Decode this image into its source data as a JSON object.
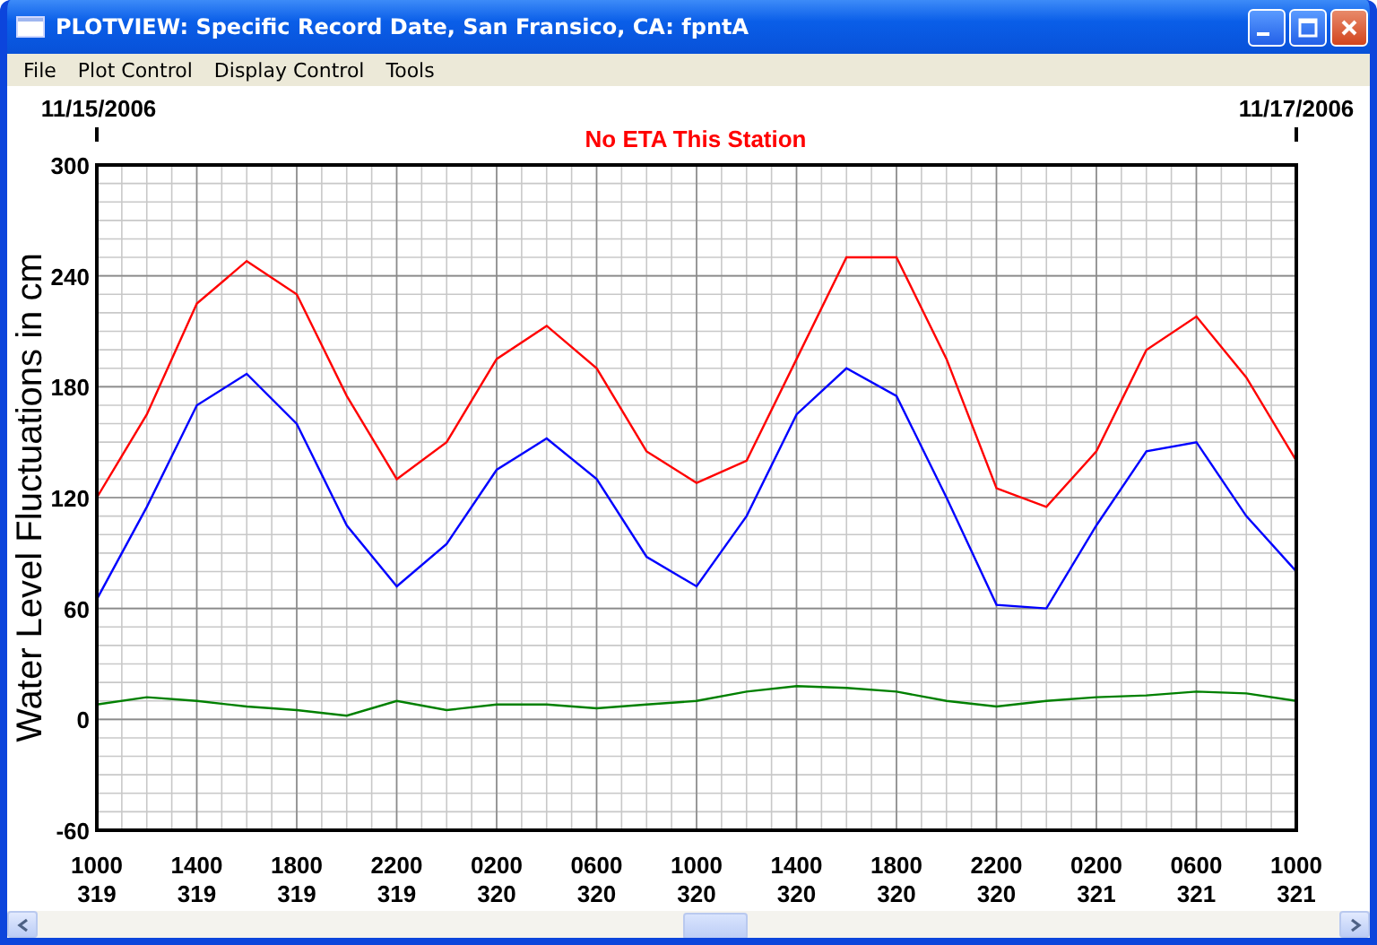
{
  "window": {
    "title": "PLOTVIEW: Specific Record Date, San Fransico, CA: fpntA"
  },
  "menu": [
    {
      "label": "File"
    },
    {
      "label": "Plot Control"
    },
    {
      "label": "Display Control"
    },
    {
      "label": "Tools"
    }
  ],
  "plot": {
    "start_date": "11/15/2006",
    "end_date": "11/17/2006",
    "chart_data": {
      "type": "line",
      "title": "No ETA This Station",
      "ylabel": "Water Level Fluctuations in cm",
      "categories": [
        "1000\n319",
        null,
        "1400\n319",
        null,
        "1800\n319",
        null,
        "2200\n319",
        null,
        "0200\n320",
        null,
        "0600\n320",
        null,
        "1000\n320",
        null,
        "1400\n320",
        null,
        "1800\n320",
        null,
        "2200\n320",
        null,
        "0200\n321",
        null,
        "0600\n321",
        null,
        "1000\n321"
      ],
      "series": [
        {
          "color": "#ff0000",
          "values": [
            120,
            165,
            225,
            248,
            230,
            175,
            130,
            150,
            195,
            213,
            190,
            145,
            128,
            140,
            195,
            250,
            250,
            195,
            125,
            115,
            145,
            200,
            218,
            185,
            140
          ]
        },
        {
          "color": "#0000ff",
          "values": [
            65,
            115,
            170,
            187,
            160,
            105,
            72,
            95,
            135,
            152,
            130,
            88,
            72,
            110,
            165,
            190,
            175,
            120,
            62,
            60,
            105,
            145,
            150,
            110,
            80
          ]
        },
        {
          "color": "#008000",
          "values": [
            8,
            12,
            10,
            7,
            5,
            2,
            10,
            5,
            8,
            8,
            6,
            8,
            10,
            15,
            18,
            17,
            15,
            10,
            7,
            10,
            12,
            13,
            15,
            14,
            10
          ]
        }
      ],
      "ylim": [
        -60,
        300
      ],
      "grid": true,
      "yticks": [
        -60,
        0,
        60,
        120,
        180,
        240,
        300
      ]
    }
  }
}
